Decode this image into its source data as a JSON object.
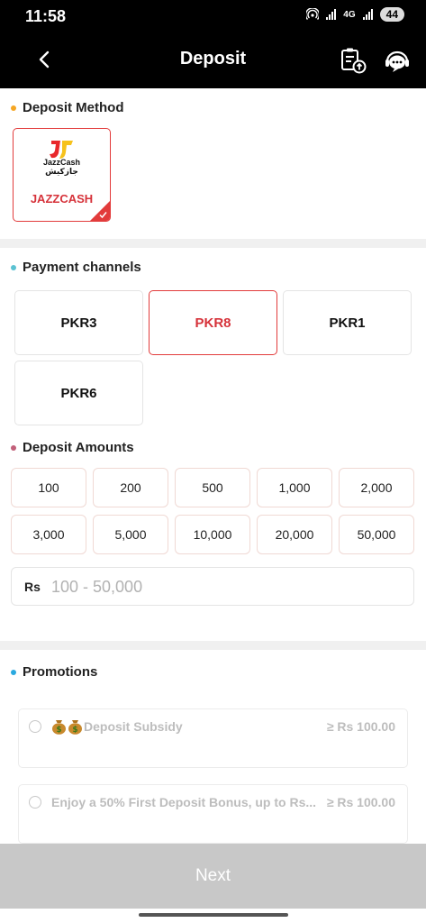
{
  "status_bar": {
    "time": "11:58",
    "network": "4G",
    "battery": "44"
  },
  "header": {
    "title": "Deposit"
  },
  "deposit_method": {
    "title": "Deposit Method",
    "dot_color": "#f5a623",
    "logo_text_en": "JazzCash",
    "logo_text_ur": "جازکیش",
    "method": "JAZZCASH"
  },
  "payment_channels": {
    "title": "Payment channels",
    "dot_color": "#5bc2d2",
    "items": [
      "PKR3",
      "PKR8",
      "PKR1",
      "PKR6"
    ],
    "selected": "PKR8"
  },
  "deposit_amounts": {
    "title": "Deposit Amounts",
    "dot_color": "#c2607a",
    "items": [
      "100",
      "200",
      "500",
      "1,000",
      "2,000",
      "3,000",
      "5,000",
      "10,000",
      "20,000",
      "50,000"
    ],
    "currency": "Rs",
    "placeholder": "100 - 50,000"
  },
  "promotions": {
    "title": "Promotions",
    "dot_color": "#2aa9e0",
    "items": [
      {
        "icons": [
          "money-bag-icon",
          "money-bag-icon"
        ],
        "text": "Deposit Subsidy",
        "min": "≥ Rs 100.00"
      },
      {
        "icons": [],
        "text": "Enjoy a 50% First Deposit Bonus, up to Rs...",
        "min": "≥ Rs 100.00"
      }
    ]
  },
  "footer": {
    "next_label": "Next"
  },
  "colors": {
    "accent": "#e23b3b",
    "disabled": "#c8c8c8"
  }
}
